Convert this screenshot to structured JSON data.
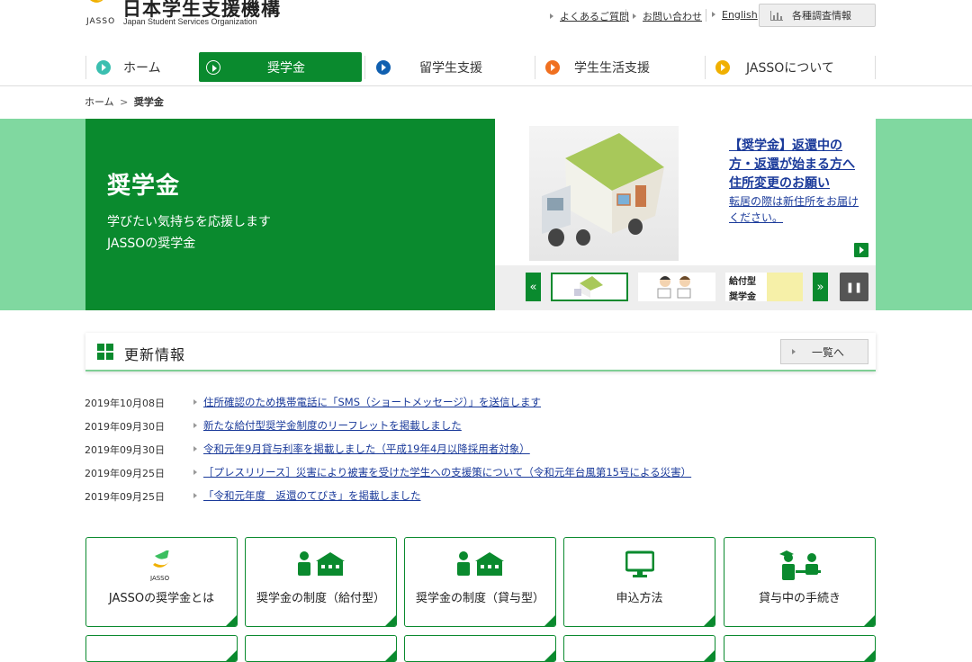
{
  "header": {
    "logo_text": "JASSO",
    "org_name_ja": "日本学生支援機構",
    "org_name_en": "Japan Student Services Organization",
    "util_links": [
      "よくあるご質問",
      "お問い合わせ",
      "English"
    ],
    "survey_button": "各種調査情報"
  },
  "nav": {
    "items": [
      {
        "label": "ホーム",
        "color": "#3bbfb0"
      },
      {
        "label": "奨学金",
        "color": "#0a8a2e"
      },
      {
        "label": "留学生支援",
        "color": "#1060b0"
      },
      {
        "label": "学生生活支援",
        "color": "#f07020"
      },
      {
        "label": "JASSOについて",
        "color": "#f0b000"
      }
    ]
  },
  "breadcrumb": {
    "home": "ホーム",
    "current": "奨学金"
  },
  "hero": {
    "title": "奨学金",
    "line1": "学びたい気持ちを応援します",
    "line2": "JASSOの奨学金",
    "feature_link": "【奨学金】返還中の方・返還が始まる方へ住所変更のお願い",
    "feature_desc": "転居の際は新住所をお届けください。",
    "thumb3_label_1": "給付型",
    "thumb3_label_2": "奨学金"
  },
  "news": {
    "title": "更新情報",
    "more": "一覧へ",
    "items": [
      {
        "date": "2019年10月08日",
        "text": "住所確認のため携帯電話に「SMS（ショートメッセージ）」を送信します"
      },
      {
        "date": "2019年09月30日",
        "text": "新たな給付型奨学金制度のリーフレットを掲載しました"
      },
      {
        "date": "2019年09月30日",
        "text": "令和元年9月貸与利率を掲載しました（平成19年4月以降採用者対象）"
      },
      {
        "date": "2019年09月25日",
        "text": "［プレスリリース］災害により被害を受けた学生への支援策について（令和元年台風第15号による災害）"
      },
      {
        "date": "2019年09月25日",
        "text": "「令和元年度　返還のてびき」を掲載しました"
      }
    ]
  },
  "tiles": [
    {
      "label": "JASSOの奨学金とは",
      "icon": "jasso-logo-icon"
    },
    {
      "label": "奨学金の制度（給付型）",
      "icon": "student-school-icon"
    },
    {
      "label": "奨学金の制度（貸与型）",
      "icon": "student-school-icon"
    },
    {
      "label": "申込方法",
      "icon": "monitor-icon"
    },
    {
      "label": "貸与中の手続き",
      "icon": "consultation-icon"
    }
  ],
  "colors": {
    "brand_green": "#0a8a2e",
    "hero_bg": "#80d8a0",
    "link": "#1a3a9a"
  }
}
